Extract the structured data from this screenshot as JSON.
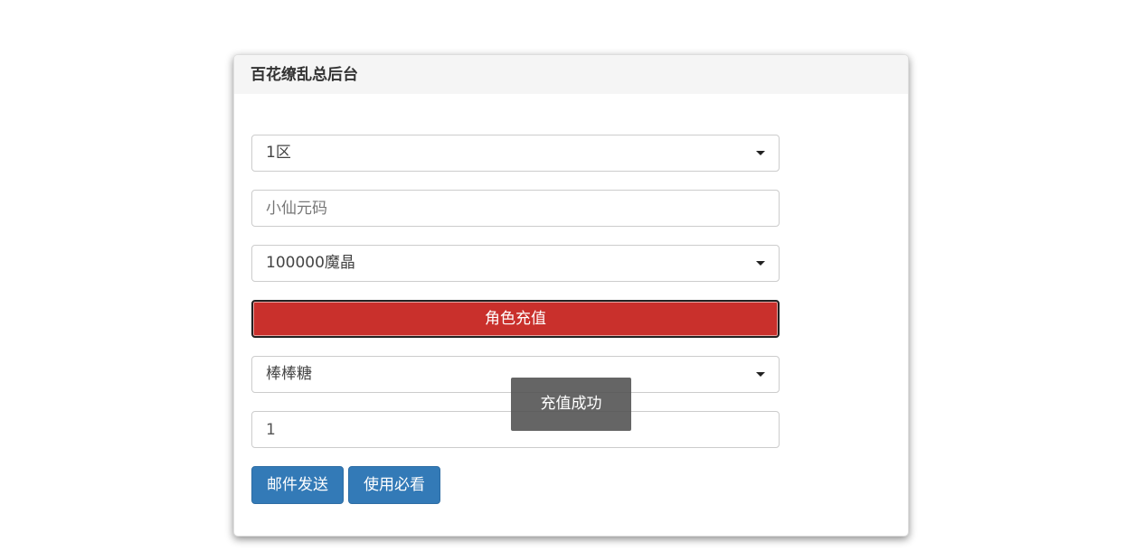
{
  "panel": {
    "title": "百花缭乱总后台"
  },
  "form": {
    "server_select": {
      "value": "1区"
    },
    "character_code_input": {
      "placeholder": "小仙元码",
      "value": ""
    },
    "recharge_amount_select": {
      "value": "100000魔晶"
    },
    "recharge_button_label": "角色充值",
    "item_select": {
      "value": "棒棒糖"
    },
    "quantity_input": {
      "value": "1"
    },
    "send_mail_label": "邮件发送",
    "usage_notes_label": "使用必看"
  },
  "toast": {
    "message": "充值成功"
  },
  "icons": {
    "dropdown": "caret-down-icon"
  },
  "colors": {
    "recharge_button": "#c9302c",
    "primary_button": "#337ab7",
    "toast_background": "#505050",
    "panel_heading": "#f5f5f5"
  }
}
